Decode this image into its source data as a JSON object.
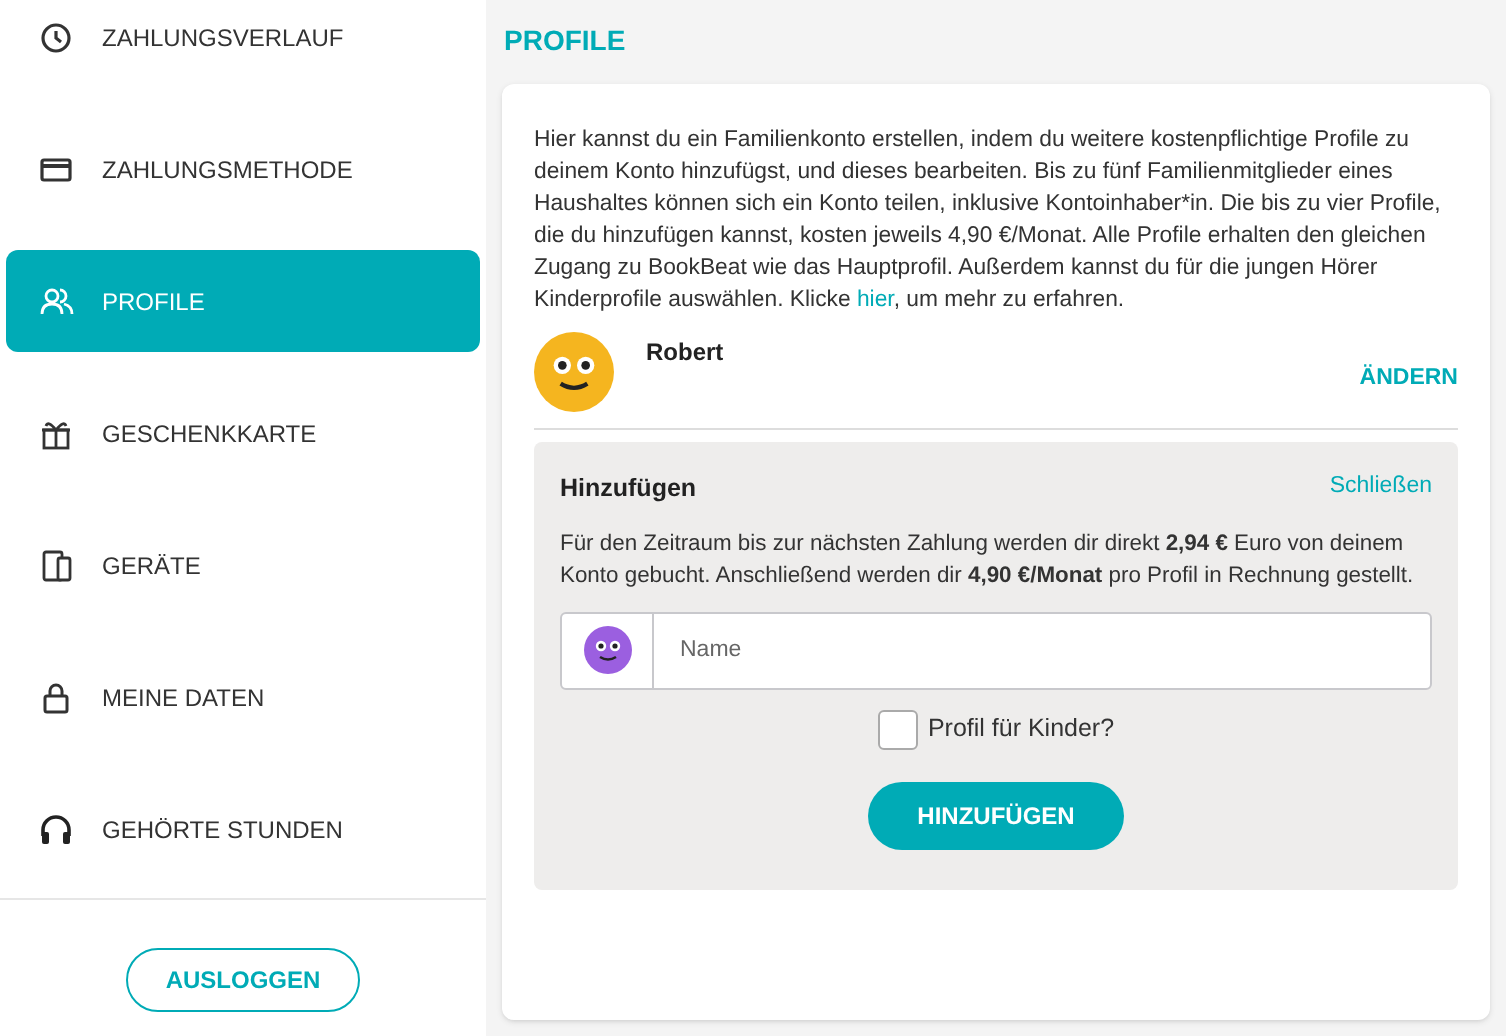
{
  "sidebar": {
    "items": [
      {
        "label": "ZAHLUNGSVERLAUF",
        "selected": false
      },
      {
        "label": "ZAHLUNGSMETHODE",
        "selected": false
      },
      {
        "label": "PROFILE",
        "selected": true
      },
      {
        "label": "GESCHENKKARTE",
        "selected": false
      },
      {
        "label": "GERÄTE",
        "selected": false
      },
      {
        "label": "MEINE DATEN",
        "selected": false
      },
      {
        "label": "GEHÖRTE STUNDEN",
        "selected": false
      }
    ],
    "logout_button": "AUSLOGGEN"
  },
  "page_title": "PROFILE",
  "intro": {
    "before": "Hier kannst du ein Familienkonto erstellen, indem du weitere kostenpflichtige Profile zu deinem Konto hinzufügst, und dieses bearbeiten. Bis zu fünf Familienmitglieder eines Haushaltes können sich ein Konto teilen, inklusive Kontoinhaber*in. Die bis zu vier Profile, die du hinzufügen kannst, kosten jeweils 4,90 €/Monat. Alle Profile erhalten den gleichen Zugang zu BookBeat wie das Hauptprofil. Außerdem kannst du für die jungen Hörer Kinderprofile auswählen. Klicke ",
    "link": "hier",
    "after": ", um mehr zu erfahren."
  },
  "profiles": [
    {
      "name": "Robert",
      "color": "#f5b51f",
      "action": "ÄNDERN"
    }
  ],
  "add_panel": {
    "title": "Hinzufügen",
    "close_link": "Schließen",
    "text": "Für den Zeitraum bis zur nächsten Zahlung werden dir direkt **2,94 €** Euro von deinem Konto gebucht. Anschließend werden dir **4,90 €/Monat** pro Profil in Rechnung gestellt.",
    "name_placeholder": "Name",
    "kids_label": "Profil für Kinder?",
    "kids_checked": false,
    "submit_button": "HINZUFÜGEN"
  }
}
